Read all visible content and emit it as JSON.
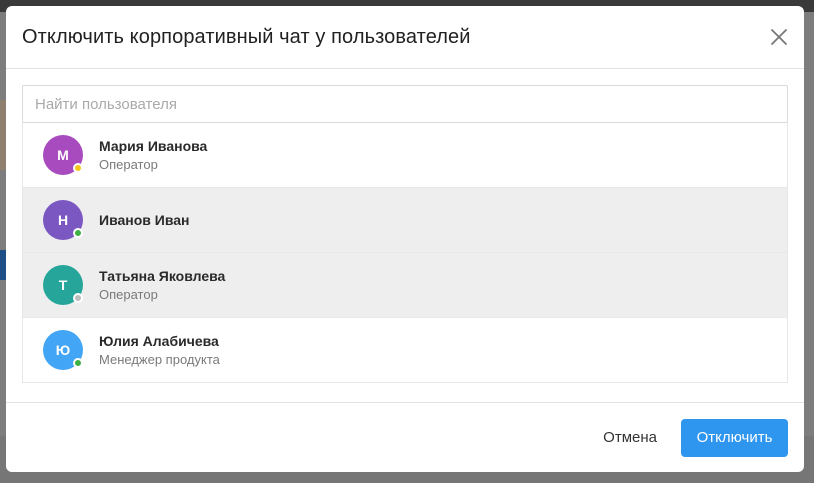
{
  "dialog": {
    "title": "Отключить корпоративный чат у пользователей",
    "close_icon": "close-icon"
  },
  "search": {
    "placeholder": "Найти пользователя",
    "value": ""
  },
  "users": [
    {
      "initial": "М",
      "name": "Мария Иванова",
      "role": "Оператор",
      "avatar_color": "#a84bbf",
      "status_color": "#f5c518",
      "selected": false
    },
    {
      "initial": "Н",
      "name": "Иванов Иван",
      "role": "",
      "avatar_color": "#7b57c2",
      "status_color": "#3cb043",
      "selected": true
    },
    {
      "initial": "Т",
      "name": "Татьяна Яковлева",
      "role": "Оператор",
      "avatar_color": "#26a69a",
      "status_color": "#bdbdbd",
      "selected": true
    },
    {
      "initial": "Ю",
      "name": "Юлия Алабичева",
      "role": "Менеджер продукта",
      "avatar_color": "#42a5f5",
      "status_color": "#3cb043",
      "selected": false
    }
  ],
  "footer": {
    "cancel_label": "Отмена",
    "confirm_label": "Отключить"
  },
  "colors": {
    "accent": "#2f96f0",
    "selected_row": "#eeeeee"
  }
}
